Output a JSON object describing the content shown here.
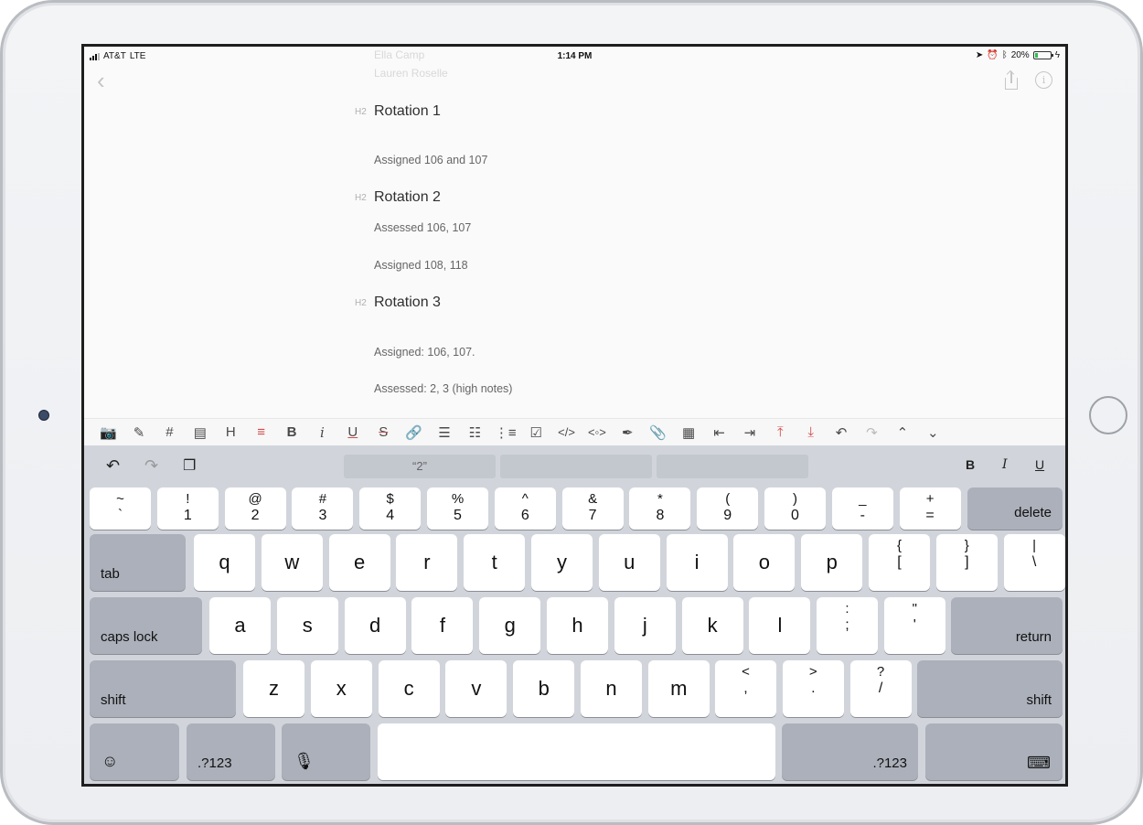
{
  "status": {
    "carrier": "AT&T",
    "network": "LTE",
    "time": "1:14 PM",
    "icons": [
      "location-icon",
      "alarm-icon",
      "bluetooth-icon"
    ],
    "battery": "20%",
    "battery_level": 0.2
  },
  "document": {
    "faded_lines": [
      "Ella Camp",
      "Lauren Roselle"
    ],
    "heading_marker": "H2",
    "sections": [
      {
        "heading": "Rotation 1",
        "paragraphs": [
          "Assigned 106 and 107"
        ]
      },
      {
        "heading": "Rotation 2",
        "paragraphs": [
          "Assessed 106, 107",
          "Assigned 108, 118"
        ]
      },
      {
        "heading": "Rotation 3",
        "paragraphs": [
          "Assigned: 106, 107.",
          "Assessed: 2, 3 (high notes)"
        ]
      }
    ]
  },
  "format_toolbar": {
    "items": [
      "camera-icon",
      "sketch-icon",
      "tag-icon",
      "note-link-icon",
      "heading-icon",
      "paragraph-icon",
      "bold-icon",
      "italic-icon",
      "underline-icon",
      "strikethrough-icon",
      "link-icon",
      "bullet-list-icon",
      "numbered-list-icon",
      "ordered-list-icon",
      "checkbox-icon",
      "code-icon",
      "code-block-icon",
      "pen-icon",
      "attachment-icon",
      "calendar-icon",
      "outdent-icon",
      "indent-icon",
      "move-up-icon",
      "move-down-icon",
      "undo-icon",
      "redo-icon",
      "chevron-up-icon",
      "chevron-down-icon"
    ]
  },
  "keyboard": {
    "suggestions": [
      "“2”",
      "",
      ""
    ],
    "format_labels": {
      "bold": "B",
      "italic": "I",
      "underline": "U"
    },
    "number_row": [
      {
        "top": "~",
        "bottom": "`"
      },
      {
        "top": "!",
        "bottom": "1"
      },
      {
        "top": "@",
        "bottom": "2"
      },
      {
        "top": "#",
        "bottom": "3"
      },
      {
        "top": "$",
        "bottom": "4"
      },
      {
        "top": "%",
        "bottom": "5"
      },
      {
        "top": "^",
        "bottom": "6"
      },
      {
        "top": "&",
        "bottom": "7"
      },
      {
        "top": "*",
        "bottom": "8"
      },
      {
        "top": "(",
        "bottom": "9"
      },
      {
        "top": ")",
        "bottom": "0"
      },
      {
        "top": "_",
        "bottom": "-"
      },
      {
        "top": "+",
        "bottom": "="
      }
    ],
    "delete_label": "delete",
    "tab_label": "tab",
    "row_q": [
      "q",
      "w",
      "e",
      "r",
      "t",
      "y",
      "u",
      "i",
      "o",
      "p"
    ],
    "row_q_symbols": [
      {
        "top": "{",
        "bottom": "["
      },
      {
        "top": "}",
        "bottom": "]"
      },
      {
        "top": "|",
        "bottom": "\\"
      }
    ],
    "caps_label": "caps lock",
    "row_a": [
      "a",
      "s",
      "d",
      "f",
      "g",
      "h",
      "j",
      "k",
      "l"
    ],
    "row_a_symbols": [
      {
        "top": ":",
        "bottom": ";"
      },
      {
        "top": "\"",
        "bottom": "'"
      }
    ],
    "return_label": "return",
    "shift_label": "shift",
    "row_z": [
      "z",
      "x",
      "c",
      "v",
      "b",
      "n",
      "m"
    ],
    "row_z_symbols": [
      {
        "top": "<",
        "bottom": ","
      },
      {
        "top": ">",
        "bottom": "."
      },
      {
        "top": "?",
        "bottom": "/"
      }
    ],
    "numbers_label": ".?123"
  }
}
